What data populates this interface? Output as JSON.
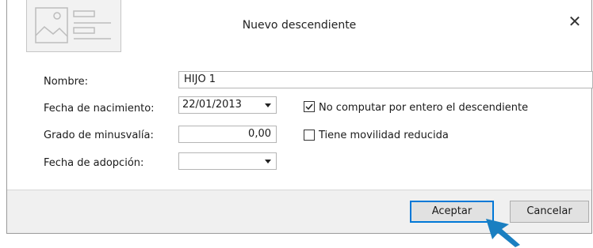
{
  "dialog": {
    "title": "Nuevo descendiente",
    "close_icon": "close-icon",
    "logo_icon": "image-placeholder-icon"
  },
  "form": {
    "nombre_label": "Nombre:",
    "nombre_value": "HIJO 1",
    "fecha_nacimiento_label": "Fecha de nacimiento:",
    "fecha_nacimiento_value": "22/01/2013",
    "grado_minusvalia_label": "Grado de minusvalía:",
    "grado_minusvalia_value": "0,00",
    "fecha_adopcion_label": "Fecha de adopción:",
    "fecha_adopcion_value": "",
    "no_computar_label": "No computar por entero el descendiente",
    "no_computar_checked": true,
    "movilidad_label": "Tiene movilidad reducida",
    "movilidad_checked": false
  },
  "footer": {
    "accept_label": "Aceptar",
    "cancel_label": "Cancelar"
  },
  "colors": {
    "pointer": "#1a7fc1",
    "focus_border": "#0078d7"
  }
}
